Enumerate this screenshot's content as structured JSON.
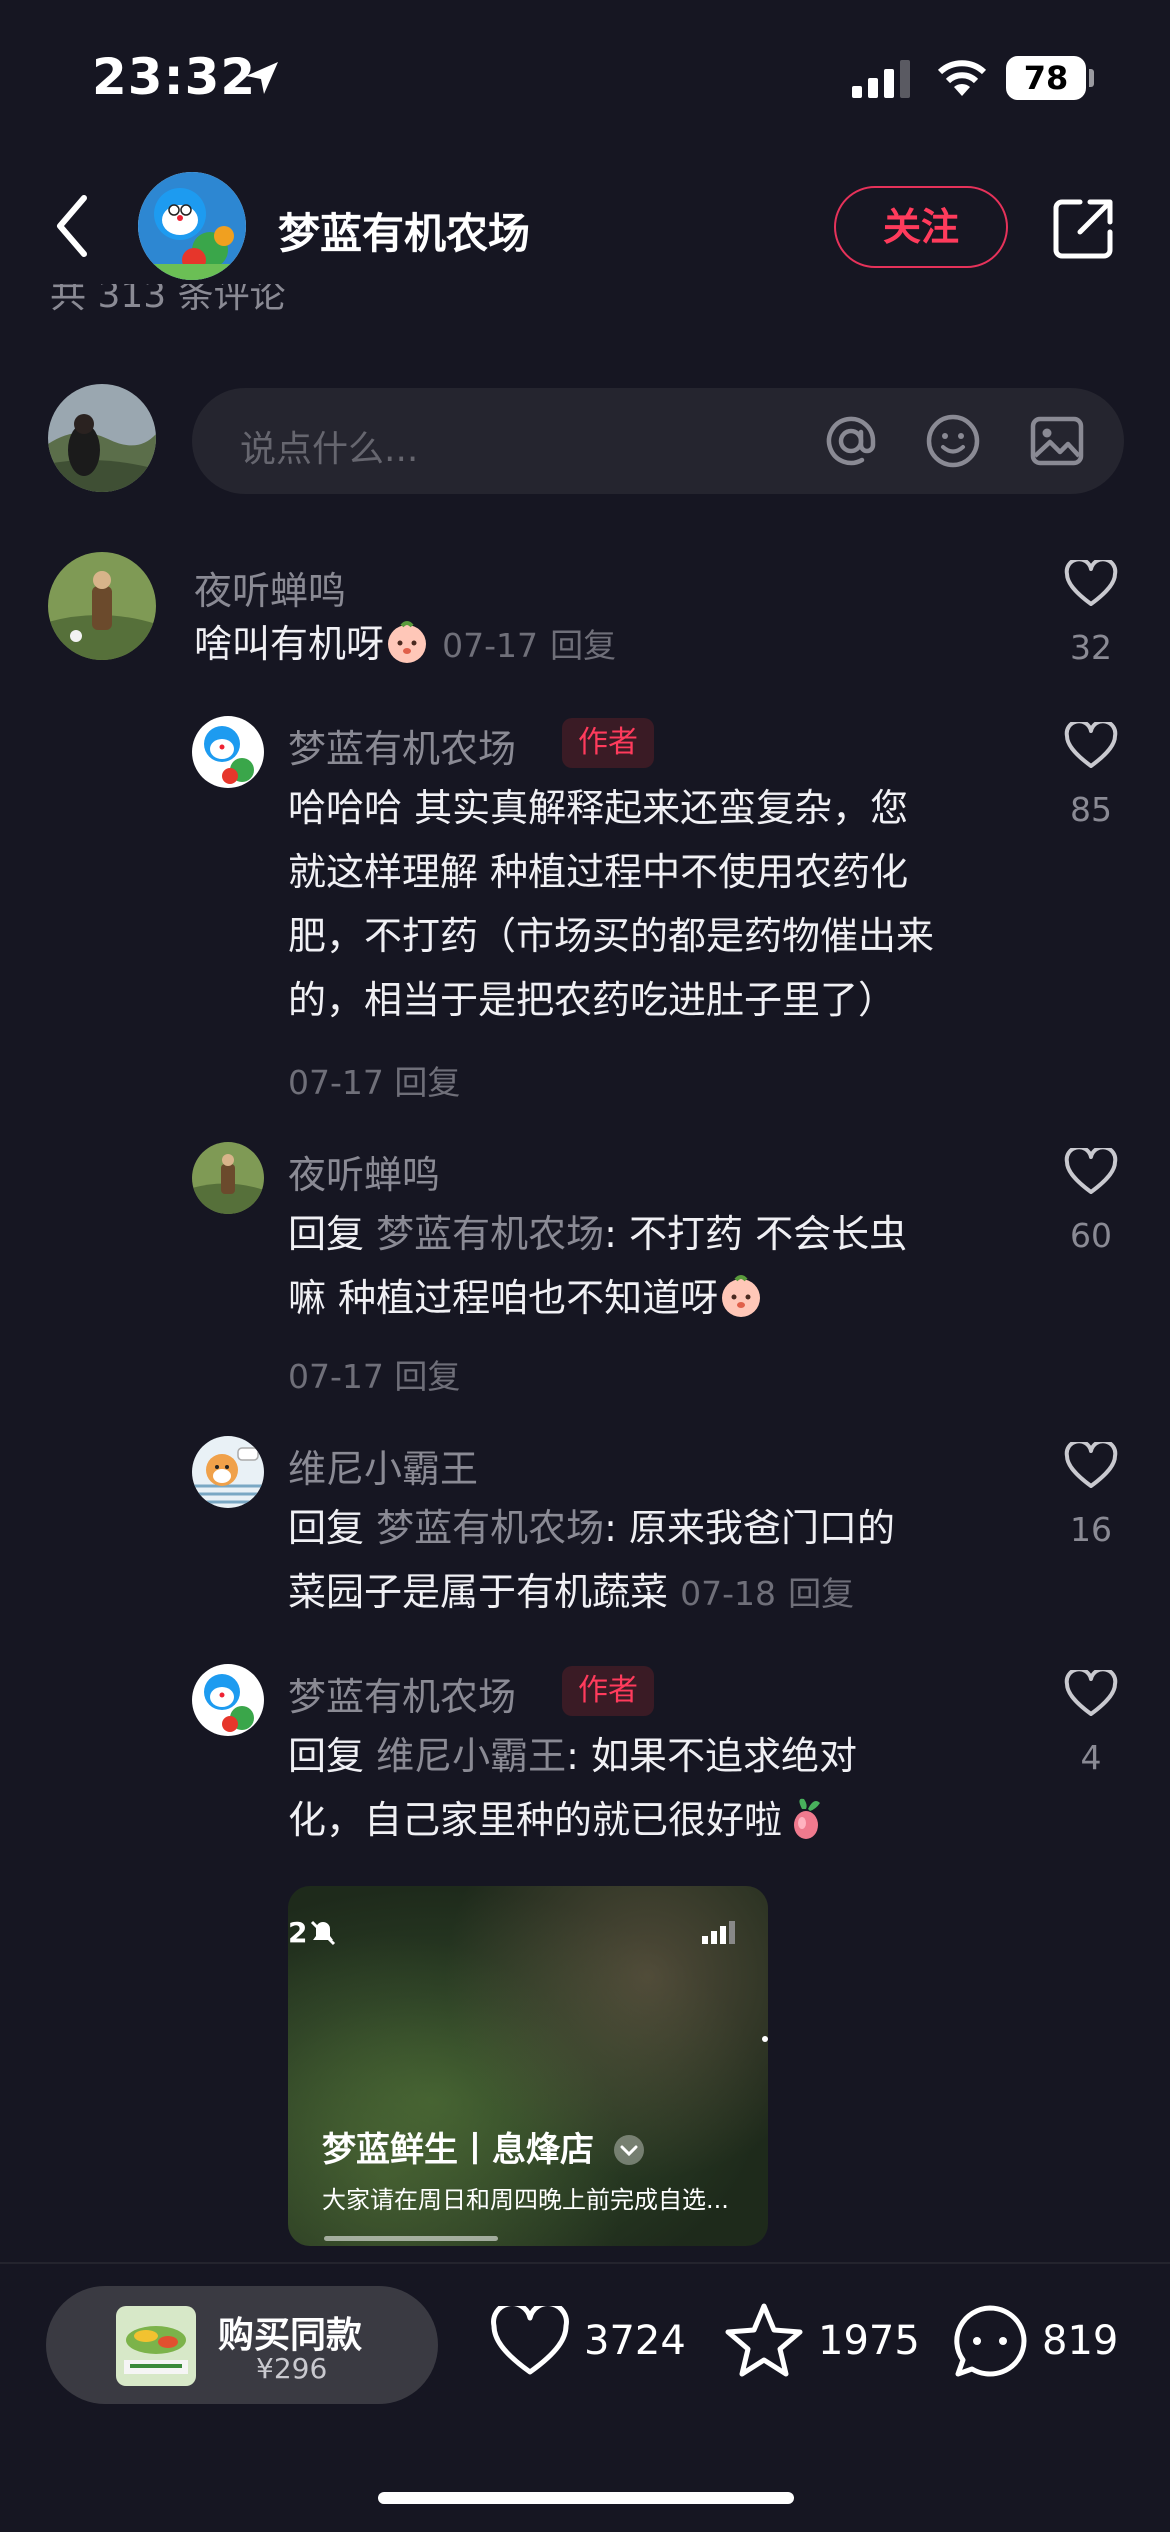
{
  "status_bar": {
    "time": "23:32",
    "battery": "78"
  },
  "header": {
    "title": "梦蓝有机农场",
    "follow_label": "关注",
    "partial_text": "共 313 条评论"
  },
  "comment_input": {
    "placeholder": "说点什么..."
  },
  "comments": [
    {
      "name": "夜听蝉鸣",
      "text": "啥叫有机呀",
      "date": "07-17",
      "reply_label": "回复",
      "likes": "32"
    }
  ],
  "replies": [
    {
      "name": "梦蓝有机农场",
      "author_tag": "作者",
      "lines": [
        "哈哈哈 其实真解释起来还蛮复杂，您",
        "就这样理解 种植过程中不使用农药化",
        "肥，不打药（市场买的都是药物催出来",
        "的，相当于是把农药吃进肚子里了）"
      ],
      "date": "07-17",
      "reply_label": "回复",
      "likes": "85"
    },
    {
      "name": "夜听蝉鸣",
      "reply_prefix": "回复",
      "reply_to": "梦蓝有机农场",
      "line1": ": 不打药  不会长虫",
      "line2": "嘛 种植过程咱也不知道呀",
      "date": "07-17",
      "reply_label": "回复",
      "likes": "60"
    },
    {
      "name": "维尼小霸王",
      "reply_prefix": "回复",
      "reply_to": "梦蓝有机农场",
      "line1": ": 原来我爸门口的",
      "line2": "菜园子是属于有机蔬菜",
      "date": "07-18",
      "reply_label": "回复",
      "likes": "16"
    },
    {
      "name": "梦蓝有机农场",
      "author_tag": "作者",
      "reply_prefix": "回复",
      "reply_to": "维尼小霸王",
      "line1": ": 如果不追求绝对",
      "line2": "化，自己家里种的就已很好啦",
      "likes": "4",
      "video": {
        "shop_name": "梦蓝鲜生丨息烽店",
        "description": "大家请在周日和周四晚上前完成自选...",
        "status_time": "2"
      }
    }
  ],
  "bottom_bar": {
    "buy_label": "购买同款",
    "price": "¥296",
    "likes": "3724",
    "favorites": "1975",
    "comments": "819"
  },
  "colors": {
    "background": "#161622",
    "accent": "#ff3b5c"
  },
  "icons": [
    "location-arrow-icon",
    "signal-icon",
    "wifi-icon",
    "battery-icon",
    "back-icon",
    "share-icon",
    "at-icon",
    "emoji-icon",
    "image-icon",
    "heart-icon",
    "star-icon",
    "comment-icon",
    "mute-icon",
    "chevron-down-icon"
  ]
}
